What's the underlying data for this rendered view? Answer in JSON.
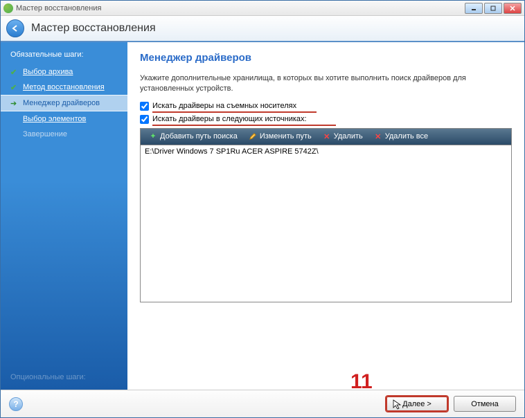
{
  "window": {
    "title": "Мастер восстановления"
  },
  "header": {
    "title": "Мастер восстановления"
  },
  "sidebar": {
    "required_heading": "Обязательные шаги:",
    "optional_heading": "Опциональные шаги:",
    "items": [
      {
        "label": "Выбор архива",
        "status": "done"
      },
      {
        "label": "Метод восстановления",
        "status": "done"
      },
      {
        "label": "Менеджер драйверов",
        "status": "current"
      },
      {
        "label": "Выбор элементов",
        "status": "pending"
      },
      {
        "label": "Завершение",
        "status": "disabled"
      }
    ]
  },
  "content": {
    "title": "Менеджер драйверов",
    "description": "Укажите дополнительные хранилища, в которых вы хотите выполнить поиск драйверов для установленных устройств.",
    "checkbox1": {
      "label": "Искать драйверы на съемных носителях",
      "checked": true
    },
    "checkbox2": {
      "label": "Искать драйверы в следующих источниках:",
      "checked": true
    },
    "toolbar": {
      "add": "Добавить путь поиска",
      "edit": "Изменить путь",
      "delete": "Удалить",
      "delete_all": "Удалить все"
    },
    "list": {
      "items": [
        "E:\\Driver Windows 7 SP1Ru ACER ASPIRE 5742Z\\"
      ]
    }
  },
  "footer": {
    "next": "Далее >",
    "cancel": "Отмена"
  },
  "annotation": {
    "number": "11"
  }
}
